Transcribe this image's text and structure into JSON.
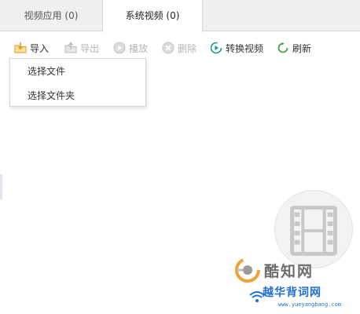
{
  "tabs": [
    {
      "label": "视频应用 (0)"
    },
    {
      "label": "系统视频 (0)"
    }
  ],
  "toolbar": {
    "import": "导入",
    "export": "导出",
    "play": "播放",
    "delete": "删除",
    "convert": "转换视频",
    "refresh": "刷新"
  },
  "import_menu": {
    "items": [
      {
        "label": "选择文件"
      },
      {
        "label": "选择文件夹"
      }
    ]
  },
  "watermarks": {
    "site1": "酷知网",
    "site2": "越华背词网",
    "site2_url": "www.yueyangbang.com"
  },
  "colors": {
    "accent_green": "#3aa64a",
    "accent_teal": "#1a9b8a",
    "icon_orange": "#f2a42a",
    "disabled": "#b5b5b5"
  },
  "icons": {
    "import": "folder-import-icon",
    "export": "folder-export-icon",
    "play": "play-icon",
    "delete": "delete-icon",
    "convert": "convert-video-icon",
    "refresh": "refresh-icon",
    "empty": "film-icon"
  }
}
